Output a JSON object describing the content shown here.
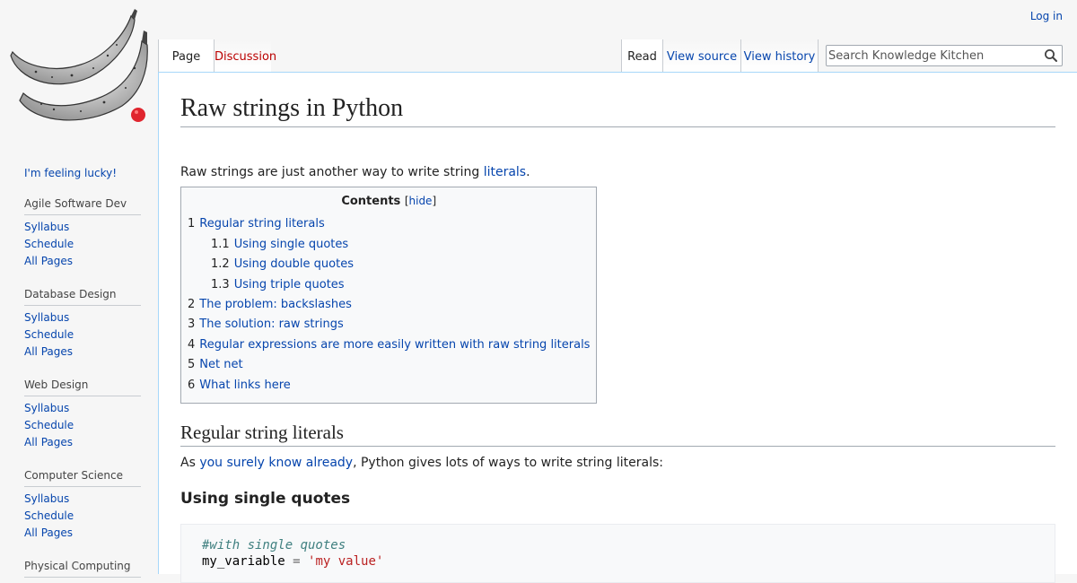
{
  "personal": {
    "login": "Log in"
  },
  "tabs": {
    "page": "Page",
    "discussion": "Discussion",
    "read": "Read",
    "view_source": "View source",
    "view_history": "View history"
  },
  "search": {
    "placeholder": "Search Knowledge Kitchen"
  },
  "sidebar": {
    "lucky": "I'm feeling lucky!",
    "sections": [
      {
        "title": "Agile Software Dev",
        "items": [
          "Syllabus",
          "Schedule",
          "All Pages"
        ]
      },
      {
        "title": "Database Design",
        "items": [
          "Syllabus",
          "Schedule",
          "All Pages"
        ]
      },
      {
        "title": "Web Design",
        "items": [
          "Syllabus",
          "Schedule",
          "All Pages"
        ]
      },
      {
        "title": "Computer Science",
        "items": [
          "Syllabus",
          "Schedule",
          "All Pages"
        ]
      },
      {
        "title": "Physical Computing",
        "items": []
      }
    ]
  },
  "article": {
    "title": "Raw strings in Python",
    "intro_text": "Raw strings are just another way to write string ",
    "intro_link": "literals",
    "intro_end": ".",
    "toc": {
      "title": "Contents",
      "hide_open": "[",
      "hide": "hide",
      "hide_close": "]",
      "items": [
        {
          "num": "1",
          "label": "Regular string literals",
          "sub": false
        },
        {
          "num": "1.1",
          "label": "Using single quotes",
          "sub": true
        },
        {
          "num": "1.2",
          "label": "Using double quotes",
          "sub": true
        },
        {
          "num": "1.3",
          "label": "Using triple quotes",
          "sub": true
        },
        {
          "num": "2",
          "label": "The problem: backslashes",
          "sub": false
        },
        {
          "num": "3",
          "label": "The solution: raw strings",
          "sub": false
        },
        {
          "num": "4",
          "label": "Regular expressions are more easily written with raw string literals",
          "sub": false
        },
        {
          "num": "5",
          "label": "Net net",
          "sub": false
        },
        {
          "num": "6",
          "label": "What links here",
          "sub": false
        }
      ]
    },
    "section1": {
      "heading": "Regular string literals",
      "para_pre": "As ",
      "para_link": "you surely know already",
      "para_post": ", Python gives lots of ways to write string literals:"
    },
    "subsection1": {
      "heading": "Using single quotes"
    },
    "code": {
      "comment": "#with single quotes",
      "var": "my_variable",
      "op": "=",
      "str": "'my value'"
    }
  }
}
